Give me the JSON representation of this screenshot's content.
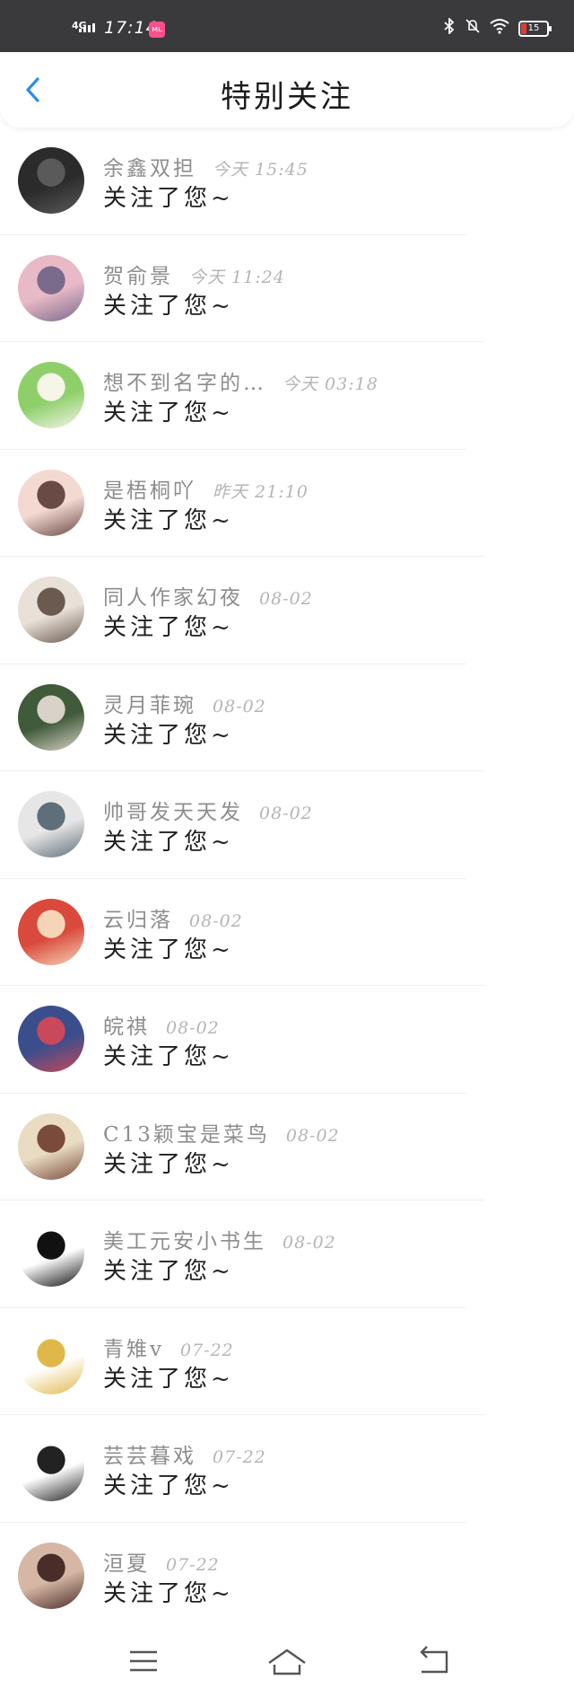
{
  "status_bar": {
    "network": "4G",
    "time": "17:14",
    "app_badge": "ᴍʟ",
    "battery": "15"
  },
  "header": {
    "title": "特别关注"
  },
  "items": [
    {
      "name": "余鑫双担",
      "time": "今天 15:45",
      "message": "关注了您~",
      "avatar_colors": [
        "#2b2b2b",
        "#5a5a5a"
      ]
    },
    {
      "name": "贺俞景",
      "time": "今天 11:24",
      "message": "关注了您~",
      "avatar_colors": [
        "#e8b9c6",
        "#7a6a8c"
      ]
    },
    {
      "name": "想不到名字的…",
      "time": "今天 03:18",
      "message": "关注了您~",
      "avatar_colors": [
        "#8ecf6a",
        "#f5f5e8"
      ]
    },
    {
      "name": "是梧桐吖",
      "time": "昨天 21:10",
      "message": "关注了您~",
      "avatar_colors": [
        "#f3d9d2",
        "#6a4a44"
      ]
    },
    {
      "name": "同人作家幻夜",
      "time": "08-02",
      "message": "关注了您~",
      "avatar_colors": [
        "#e9e1d8",
        "#6b5a50"
      ]
    },
    {
      "name": "灵月菲琬",
      "time": "08-02",
      "message": "关注了您~",
      "avatar_colors": [
        "#3f5b3a",
        "#d9d2c8"
      ]
    },
    {
      "name": "帅哥发天天发",
      "time": "08-02",
      "message": "关注了您~",
      "avatar_colors": [
        "#e6e6e6",
        "#5e6e7a"
      ]
    },
    {
      "name": "云归落",
      "time": "08-02",
      "message": "关注了您~",
      "avatar_colors": [
        "#d94a3c",
        "#f6d4b8"
      ]
    },
    {
      "name": "皖祺",
      "time": "08-02",
      "message": "关注了您~",
      "avatar_colors": [
        "#3b4e8c",
        "#c9485b"
      ]
    },
    {
      "name": "C13颖宝是菜鸟",
      "time": "08-02",
      "message": "关注了您~",
      "avatar_colors": [
        "#e9dcc3",
        "#7a4a3a"
      ]
    },
    {
      "name": "美工元安小书生",
      "time": "08-02",
      "message": "关注了您~",
      "avatar_colors": [
        "#ffffff",
        "#111111"
      ]
    },
    {
      "name": "青雉v",
      "time": "07-22",
      "message": "关注了您~",
      "avatar_colors": [
        "#ffffff",
        "#e0b84a"
      ]
    },
    {
      "name": "芸芸暮戏",
      "time": "07-22",
      "message": "关注了您~",
      "avatar_colors": [
        "#ffffff",
        "#222222"
      ]
    },
    {
      "name": "洹夏",
      "time": "07-22",
      "message": "关注了您~",
      "avatar_colors": [
        "#d6b7a6",
        "#4a2c28"
      ]
    }
  ],
  "icons": {
    "back": "chevron-left-icon",
    "menu": "menu-icon",
    "home": "home-icon",
    "back_nav": "return-icon"
  },
  "colors": {
    "accent": "#2a8ee6",
    "status_bar": "#3a3a3c"
  }
}
